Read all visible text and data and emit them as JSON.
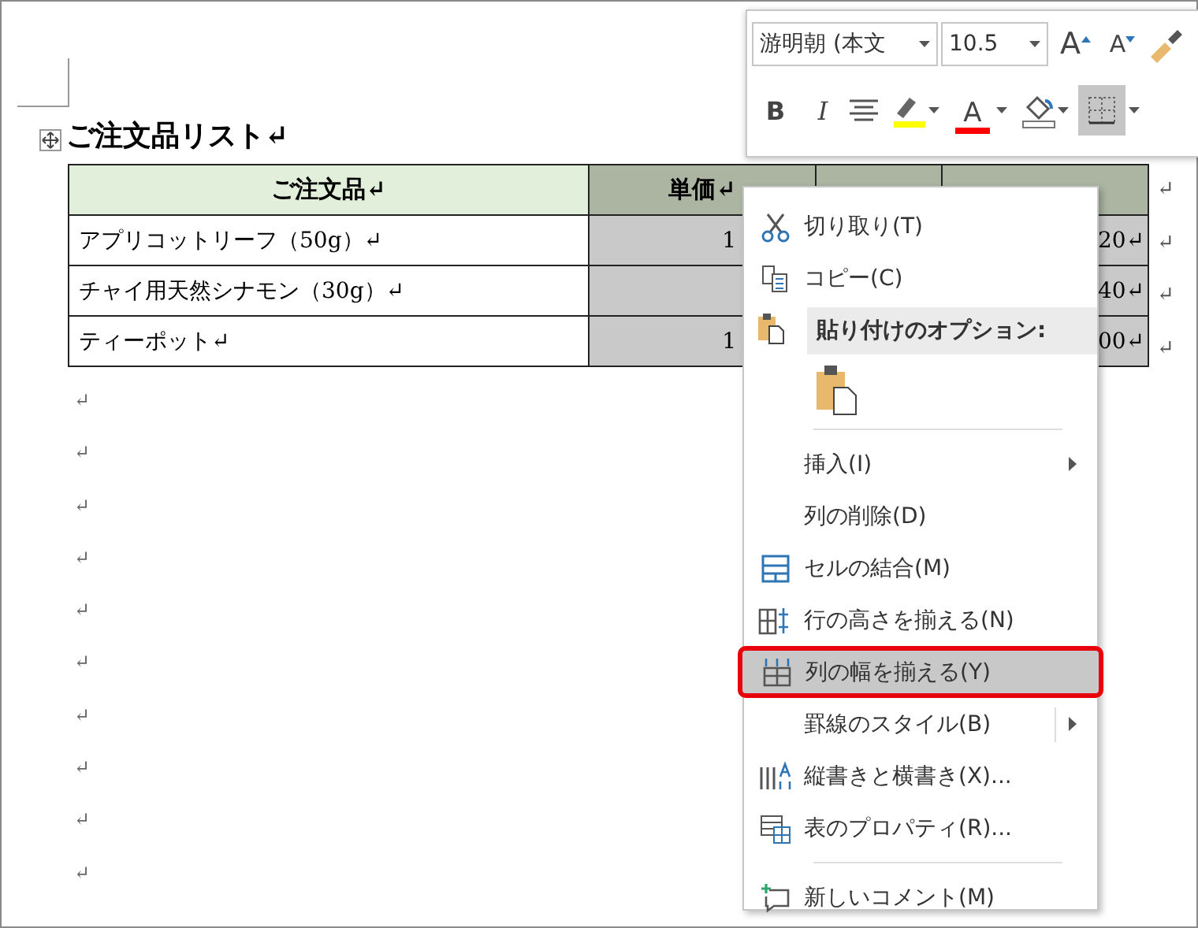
{
  "document": {
    "title": "ご注文品リスト↵",
    "table": {
      "columns": [
        {
          "label": "ご注文品↵",
          "selected": false
        },
        {
          "label": "単価↵",
          "selected": true
        },
        {
          "selected": true
        },
        {
          "selected": true
        }
      ],
      "rows": [
        {
          "cells": [
            "アプリコットリーフ（50g）↵",
            "1",
            "",
            "20↵"
          ],
          "end": "↵"
        },
        {
          "cells": [
            "チャイ用天然シナモン（30g）↵",
            "",
            "",
            "40↵"
          ],
          "end": "↵"
        },
        {
          "cells": [
            "ティーポット↵",
            "1",
            "",
            "00↵"
          ],
          "end": "↵"
        }
      ],
      "header_end": "↵"
    },
    "empty_paragraphs": [
      "↵",
      "↵",
      "↵",
      "↵",
      "↵",
      "↵",
      "↵",
      "↵",
      "↵",
      "↵"
    ]
  },
  "mini_toolbar": {
    "font": "游明朝 (本文",
    "size": "10.5",
    "grow_label": "A",
    "shrink_label": "A",
    "bold_label": "B",
    "italic_label": "I",
    "font_color_label": "A",
    "borders_selected": true
  },
  "context_menu": {
    "items": [
      {
        "kind": "item",
        "label": "切り取り(T)",
        "selected": false,
        "submenu": false
      },
      {
        "kind": "item",
        "label": "コピー(C)",
        "selected": false,
        "submenu": false
      },
      {
        "kind": "header",
        "label": "貼り付けのオプション:"
      },
      {
        "kind": "paste"
      },
      {
        "kind": "separator"
      },
      {
        "kind": "item",
        "label": "挿入(I)",
        "selected": false,
        "submenu": true
      },
      {
        "kind": "item",
        "label": "列の削除(D)",
        "selected": false,
        "submenu": false
      },
      {
        "kind": "item",
        "label": "セルの結合(M)",
        "selected": false,
        "submenu": false
      },
      {
        "kind": "item",
        "label": "行の高さを揃える(N)",
        "selected": false,
        "submenu": false
      },
      {
        "kind": "item",
        "label": "列の幅を揃える(Y)",
        "selected": true,
        "submenu": false
      },
      {
        "kind": "item",
        "label": "罫線のスタイル(B)",
        "selected": false,
        "submenu": true,
        "split": true
      },
      {
        "kind": "item",
        "label": "縦書きと横書き(X)...",
        "selected": false,
        "submenu": false
      },
      {
        "kind": "item",
        "label": "表のプロパティ(R)...",
        "selected": false,
        "submenu": false
      },
      {
        "kind": "separator"
      },
      {
        "kind": "item",
        "label": "新しいコメント(M)",
        "selected": false,
        "submenu": false
      }
    ]
  }
}
